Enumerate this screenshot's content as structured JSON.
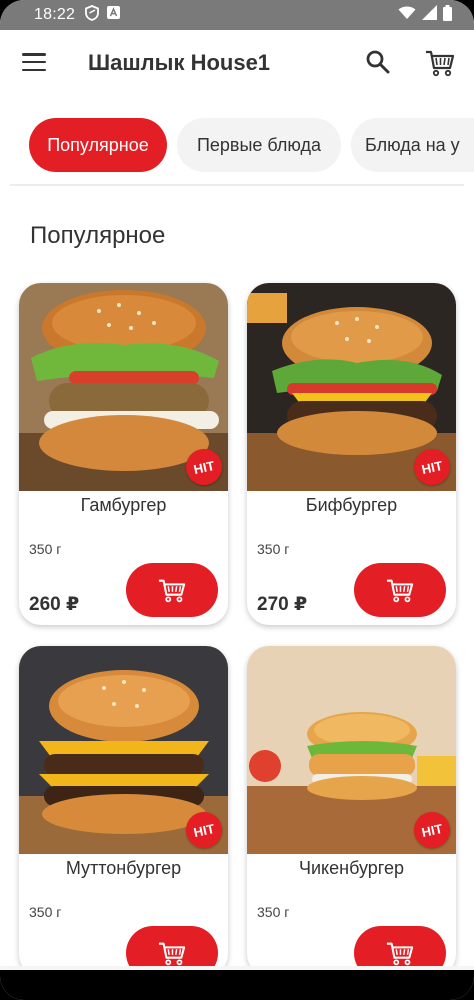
{
  "status_bar": {
    "time": "18:22",
    "icons": [
      "shield-icon",
      "a-notification-icon",
      "wifi-icon",
      "signal-icon",
      "battery-icon"
    ]
  },
  "app_bar": {
    "title": "Шашлык House1",
    "icons": [
      "menu-icon",
      "search-icon",
      "cart-icon"
    ]
  },
  "categories": [
    {
      "label": "Популярное",
      "active": true
    },
    {
      "label": "Первые блюда",
      "active": false
    },
    {
      "label": "Блюда на у",
      "active": false
    }
  ],
  "section": {
    "title": "Популярное"
  },
  "products": [
    {
      "name": "Гамбургер",
      "weight": "350 г",
      "price": "260 ₽",
      "badge": "HIT"
    },
    {
      "name": "Бифбургер",
      "weight": "350 г",
      "price": "270 ₽",
      "badge": "HIT"
    },
    {
      "name": "Муттонбургер",
      "weight": "350 г",
      "price": "",
      "badge": "HIT"
    },
    {
      "name": "Чикенбургер",
      "weight": "350 г",
      "price": "",
      "badge": "HIT"
    }
  ],
  "colors": {
    "accent": "#e31e24",
    "chip_inactive": "#f3f3f3",
    "text": "#333333"
  }
}
